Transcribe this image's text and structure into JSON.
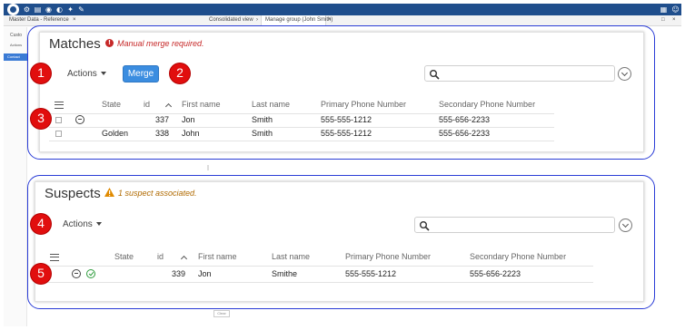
{
  "app": {
    "tabs": [
      "Master Data - Reference",
      "Consolidated view",
      "Manage group (John Smith)"
    ]
  },
  "background": {
    "left_lines": [
      "Custo",
      "Actions"
    ],
    "contact_label": "Contact",
    "small_box_label": "Clear"
  },
  "matches": {
    "title": "Matches",
    "alert_text": "Manual merge required.",
    "actions_label": "Actions",
    "merge_label": "Merge",
    "search_placeholder": "",
    "columns": [
      "State",
      "id",
      "First name",
      "Last name",
      "Primary Phone Number",
      "Secondary Phone Number"
    ],
    "rows": [
      {
        "state": "",
        "id": "337",
        "first": "Jon",
        "last": "Smith",
        "primary": "555-555-1212",
        "secondary": "555-656-2233"
      },
      {
        "state": "Golden",
        "id": "338",
        "first": "John",
        "last": "Smith",
        "primary": "555-555-1212",
        "secondary": "555-656-2233"
      }
    ]
  },
  "suspects": {
    "title": "Suspects",
    "alert_text": "1 suspect associated.",
    "actions_label": "Actions",
    "search_placeholder": "",
    "columns": [
      "State",
      "id",
      "First name",
      "Last name",
      "Primary Phone Number",
      "Secondary Phone Number"
    ],
    "rows": [
      {
        "state": "",
        "id": "339",
        "first": "Jon",
        "last": "Smithe",
        "primary": "555-555-1212",
        "secondary": "555-656-2223"
      }
    ]
  },
  "callouts": [
    "1",
    "2",
    "3",
    "4",
    "5"
  ],
  "colors": {
    "callout_red": "#e10e0e",
    "panel_border": "#2a3cd6",
    "merge_blue": "#3b8de0",
    "error_red": "#c62828",
    "warning_orange": "#e08a00",
    "toolbar_blue": "#1f4e8c"
  }
}
